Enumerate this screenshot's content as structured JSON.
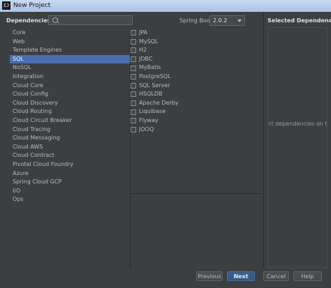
{
  "window": {
    "title": "New Project",
    "icon_text": "IJ"
  },
  "header": {
    "dependencies_label": "Dependencies",
    "search_placeholder": "",
    "spring_boot_label": "Spring Boot",
    "spring_boot_version": "2.0.2"
  },
  "categories": [
    {
      "label": "Core"
    },
    {
      "label": "Web"
    },
    {
      "label": "Template Engines"
    },
    {
      "label": "SQL"
    },
    {
      "label": "NoSQL"
    },
    {
      "label": "Integration"
    },
    {
      "label": "Cloud Core"
    },
    {
      "label": "Cloud Config"
    },
    {
      "label": "Cloud Discovery"
    },
    {
      "label": "Cloud Routing"
    },
    {
      "label": "Cloud Circuit Breaker"
    },
    {
      "label": "Cloud Tracing"
    },
    {
      "label": "Cloud Messaging"
    },
    {
      "label": "Cloud AWS"
    },
    {
      "label": "Cloud Contract"
    },
    {
      "label": "Pivotal Cloud Foundry"
    },
    {
      "label": "Azure"
    },
    {
      "label": "Spring Cloud GCP"
    },
    {
      "label": "I/O"
    },
    {
      "label": "Ops"
    }
  ],
  "selected_category_index": 3,
  "dependencies": [
    {
      "label": "JPA",
      "checked": false
    },
    {
      "label": "MySQL",
      "checked": false
    },
    {
      "label": "H2",
      "checked": false
    },
    {
      "label": "JDBC",
      "checked": false
    },
    {
      "label": "MyBatis",
      "checked": false
    },
    {
      "label": "PostgreSQL",
      "checked": false
    },
    {
      "label": "SQL Server",
      "checked": false
    },
    {
      "label": "HSQLDB",
      "checked": false
    },
    {
      "label": "Apache Derby",
      "checked": false
    },
    {
      "label": "Liquibase",
      "checked": false
    },
    {
      "label": "Flyway",
      "checked": false
    },
    {
      "label": "JOOQ",
      "checked": false
    }
  ],
  "selected_panel": {
    "title": "Selected Dependencies",
    "empty_text": "ıct dependencies on the"
  },
  "buttons": {
    "previous": "Previous",
    "next": "Next",
    "cancel": "Cancel",
    "help": "Help"
  }
}
